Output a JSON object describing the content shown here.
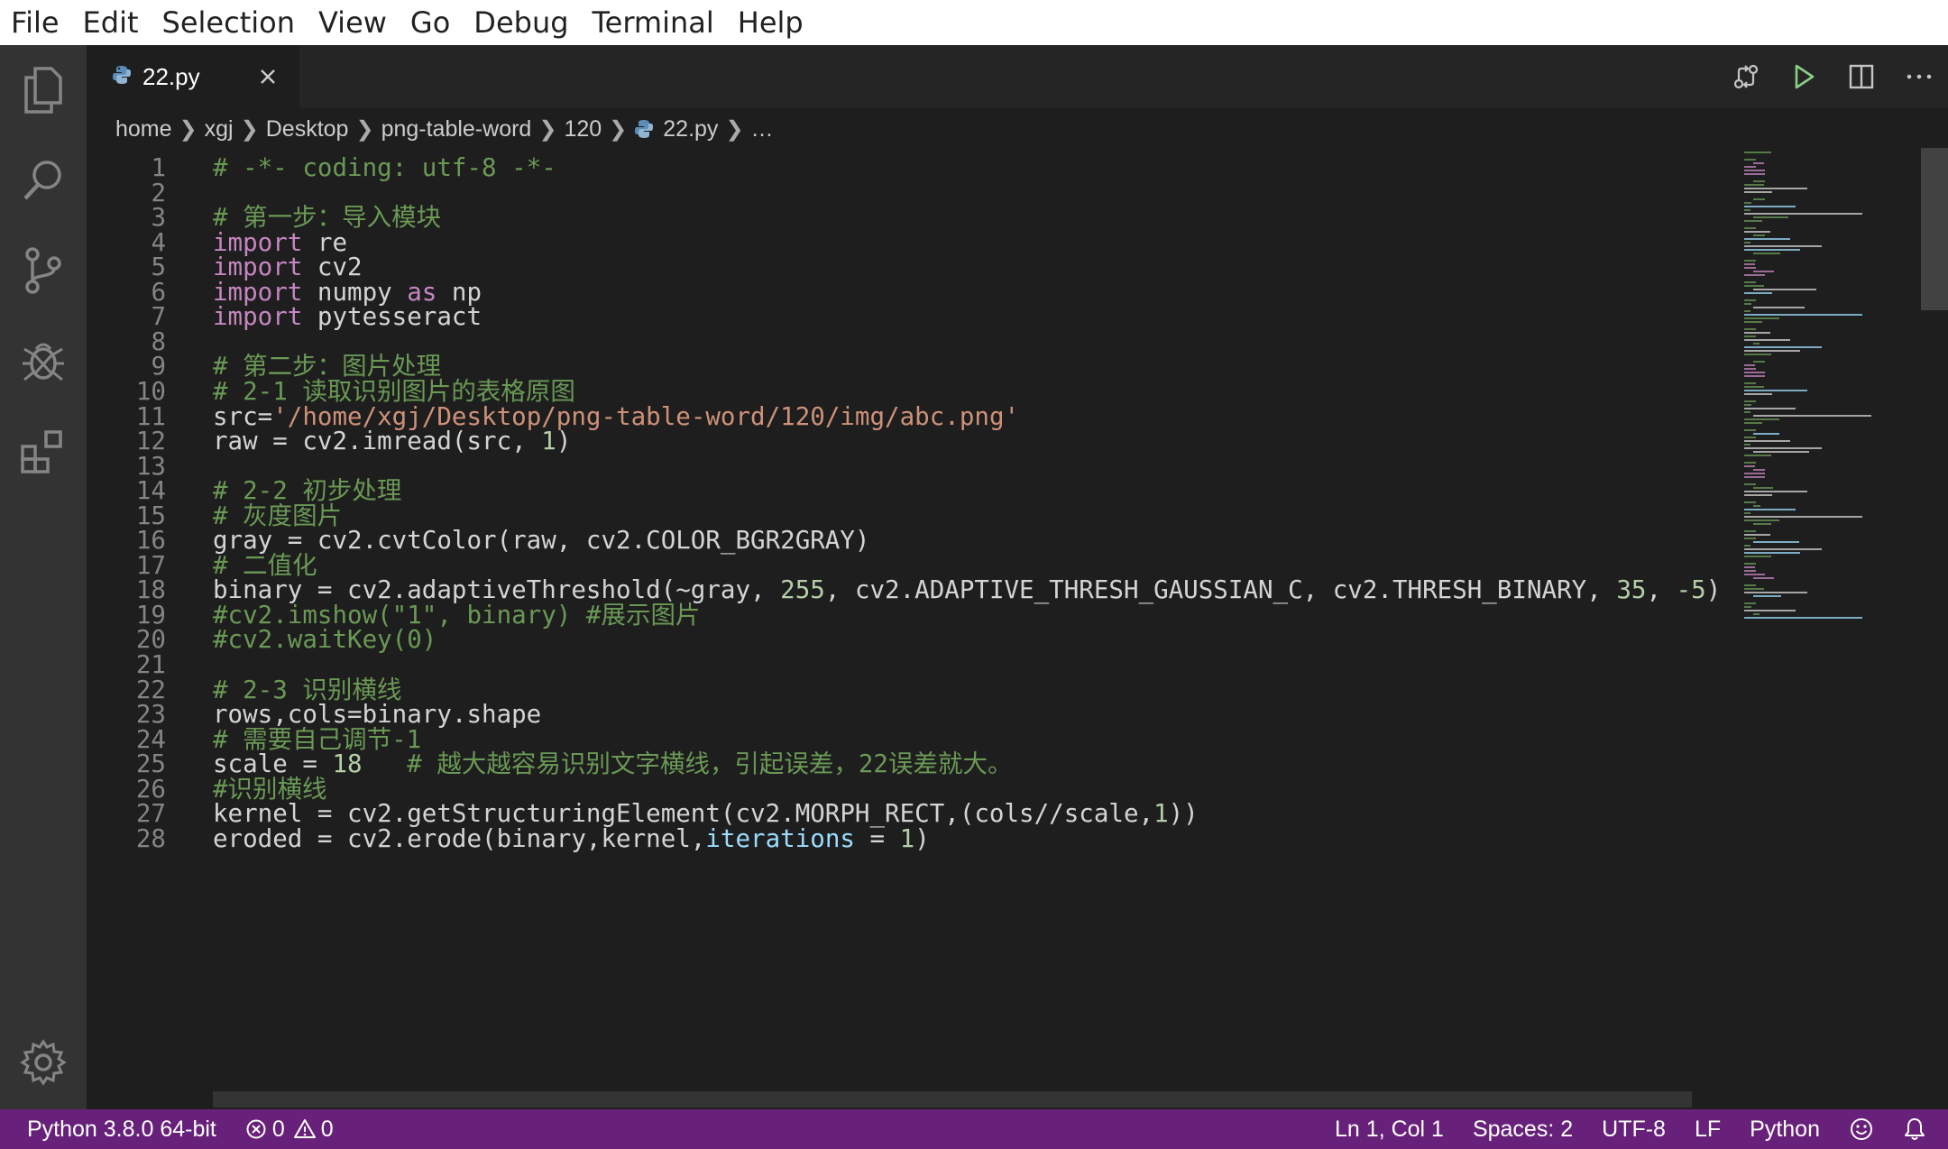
{
  "menu": [
    "File",
    "Edit",
    "Selection",
    "View",
    "Go",
    "Debug",
    "Terminal",
    "Help"
  ],
  "activity_bar": [
    "explorer-icon",
    "search-icon",
    "source-control-icon",
    "debug-icon",
    "extensions-icon",
    "settings-gear-icon"
  ],
  "tab": {
    "filename": "22.py",
    "icon": "python-file-icon"
  },
  "editor_actions": [
    "open-changes-icon",
    "run-icon",
    "split-editor-icon",
    "more-actions-icon"
  ],
  "breadcrumb": [
    "home",
    "xgj",
    "Desktop",
    "png-table-word",
    "120",
    "22.py",
    "…"
  ],
  "code_lines": [
    {
      "n": "1",
      "t": [
        [
          "c",
          "# -*- coding: utf-8 -*-"
        ]
      ]
    },
    {
      "n": "2",
      "t": []
    },
    {
      "n": "3",
      "t": [
        [
          "c",
          "# 第一步：导入模块"
        ]
      ]
    },
    {
      "n": "4",
      "t": [
        [
          "k",
          "import"
        ],
        [
          "p",
          " re"
        ]
      ]
    },
    {
      "n": "5",
      "t": [
        [
          "k",
          "import"
        ],
        [
          "p",
          " cv2"
        ]
      ]
    },
    {
      "n": "6",
      "t": [
        [
          "k",
          "import"
        ],
        [
          "p",
          " numpy "
        ],
        [
          "k",
          "as"
        ],
        [
          "p",
          " np"
        ]
      ]
    },
    {
      "n": "7",
      "t": [
        [
          "k",
          "import"
        ],
        [
          "p",
          " pytesseract"
        ]
      ]
    },
    {
      "n": "8",
      "t": []
    },
    {
      "n": "9",
      "t": [
        [
          "c",
          "# 第二步：图片处理"
        ]
      ]
    },
    {
      "n": "10",
      "t": [
        [
          "c",
          "# 2-1 读取识别图片的表格原图"
        ]
      ]
    },
    {
      "n": "11",
      "t": [
        [
          "p",
          "src="
        ],
        [
          "s",
          "'/home/xgj/Desktop/png-table-word/120/img/abc.png'"
        ]
      ]
    },
    {
      "n": "12",
      "t": [
        [
          "p",
          "raw = cv2.imread(src, "
        ],
        [
          "n",
          "1"
        ],
        [
          "p",
          ")"
        ]
      ]
    },
    {
      "n": "13",
      "t": []
    },
    {
      "n": "14",
      "t": [
        [
          "c",
          "# 2-2 初步处理"
        ]
      ]
    },
    {
      "n": "15",
      "t": [
        [
          "c",
          "# 灰度图片"
        ]
      ]
    },
    {
      "n": "16",
      "t": [
        [
          "p",
          "gray = cv2.cvtColor(raw, cv2.COLOR_BGR2GRAY)"
        ]
      ]
    },
    {
      "n": "17",
      "t": [
        [
          "c",
          "# 二值化"
        ]
      ]
    },
    {
      "n": "18",
      "t": [
        [
          "p",
          "binary = cv2.adaptiveThreshold(~gray, "
        ],
        [
          "n",
          "255"
        ],
        [
          "p",
          ", cv2.ADAPTIVE_THRESH_GAUSSIAN_C, cv2.THRESH_BINARY, "
        ],
        [
          "n",
          "35"
        ],
        [
          "p",
          ", "
        ],
        [
          "n",
          "-5"
        ],
        [
          "p",
          ")"
        ]
      ]
    },
    {
      "n": "19",
      "t": [
        [
          "c",
          "#cv2.imshow(\"1\", binary) #展示图片"
        ]
      ]
    },
    {
      "n": "20",
      "t": [
        [
          "c",
          "#cv2.waitKey(0)"
        ]
      ]
    },
    {
      "n": "21",
      "t": []
    },
    {
      "n": "22",
      "t": [
        [
          "c",
          "# 2-3 识别横线"
        ]
      ]
    },
    {
      "n": "23",
      "t": [
        [
          "p",
          "rows,cols=binary.shape"
        ]
      ]
    },
    {
      "n": "24",
      "t": [
        [
          "c",
          "# 需要自己调节-1"
        ]
      ]
    },
    {
      "n": "25",
      "t": [
        [
          "p",
          "scale = "
        ],
        [
          "n",
          "18"
        ],
        [
          "p",
          "   "
        ],
        [
          "c",
          "# 越大越容易识别文字横线，引起误差，22误差就大。"
        ]
      ]
    },
    {
      "n": "26",
      "t": [
        [
          "c",
          "#识别横线"
        ]
      ]
    },
    {
      "n": "27",
      "t": [
        [
          "p",
          "kernel = cv2.getStructuringElement(cv2.MORPH_RECT,(cols//scale,"
        ],
        [
          "n",
          "1"
        ],
        [
          "p",
          "))"
        ]
      ]
    },
    {
      "n": "28",
      "t": [
        [
          "p",
          "eroded = cv2.erode(binary,kernel,"
        ],
        [
          "a",
          "iterations"
        ],
        [
          "p",
          " = "
        ],
        [
          "n",
          "1"
        ],
        [
          "p",
          ")"
        ]
      ]
    }
  ],
  "status": {
    "interpreter": "Python 3.8.0 64-bit",
    "errors": "0",
    "warnings": "0",
    "position": "Ln 1, Col 1",
    "spaces": "Spaces: 2",
    "encoding": "UTF-8",
    "eol": "LF",
    "language": "Python"
  },
  "colors": {
    "status_bar": "#68217a",
    "comment": "#6a9955",
    "keyword": "#c586c0",
    "string": "#ce9178",
    "number": "#b5cea8",
    "parameter": "#9cdcfe",
    "plain": "#d4d4d4"
  }
}
